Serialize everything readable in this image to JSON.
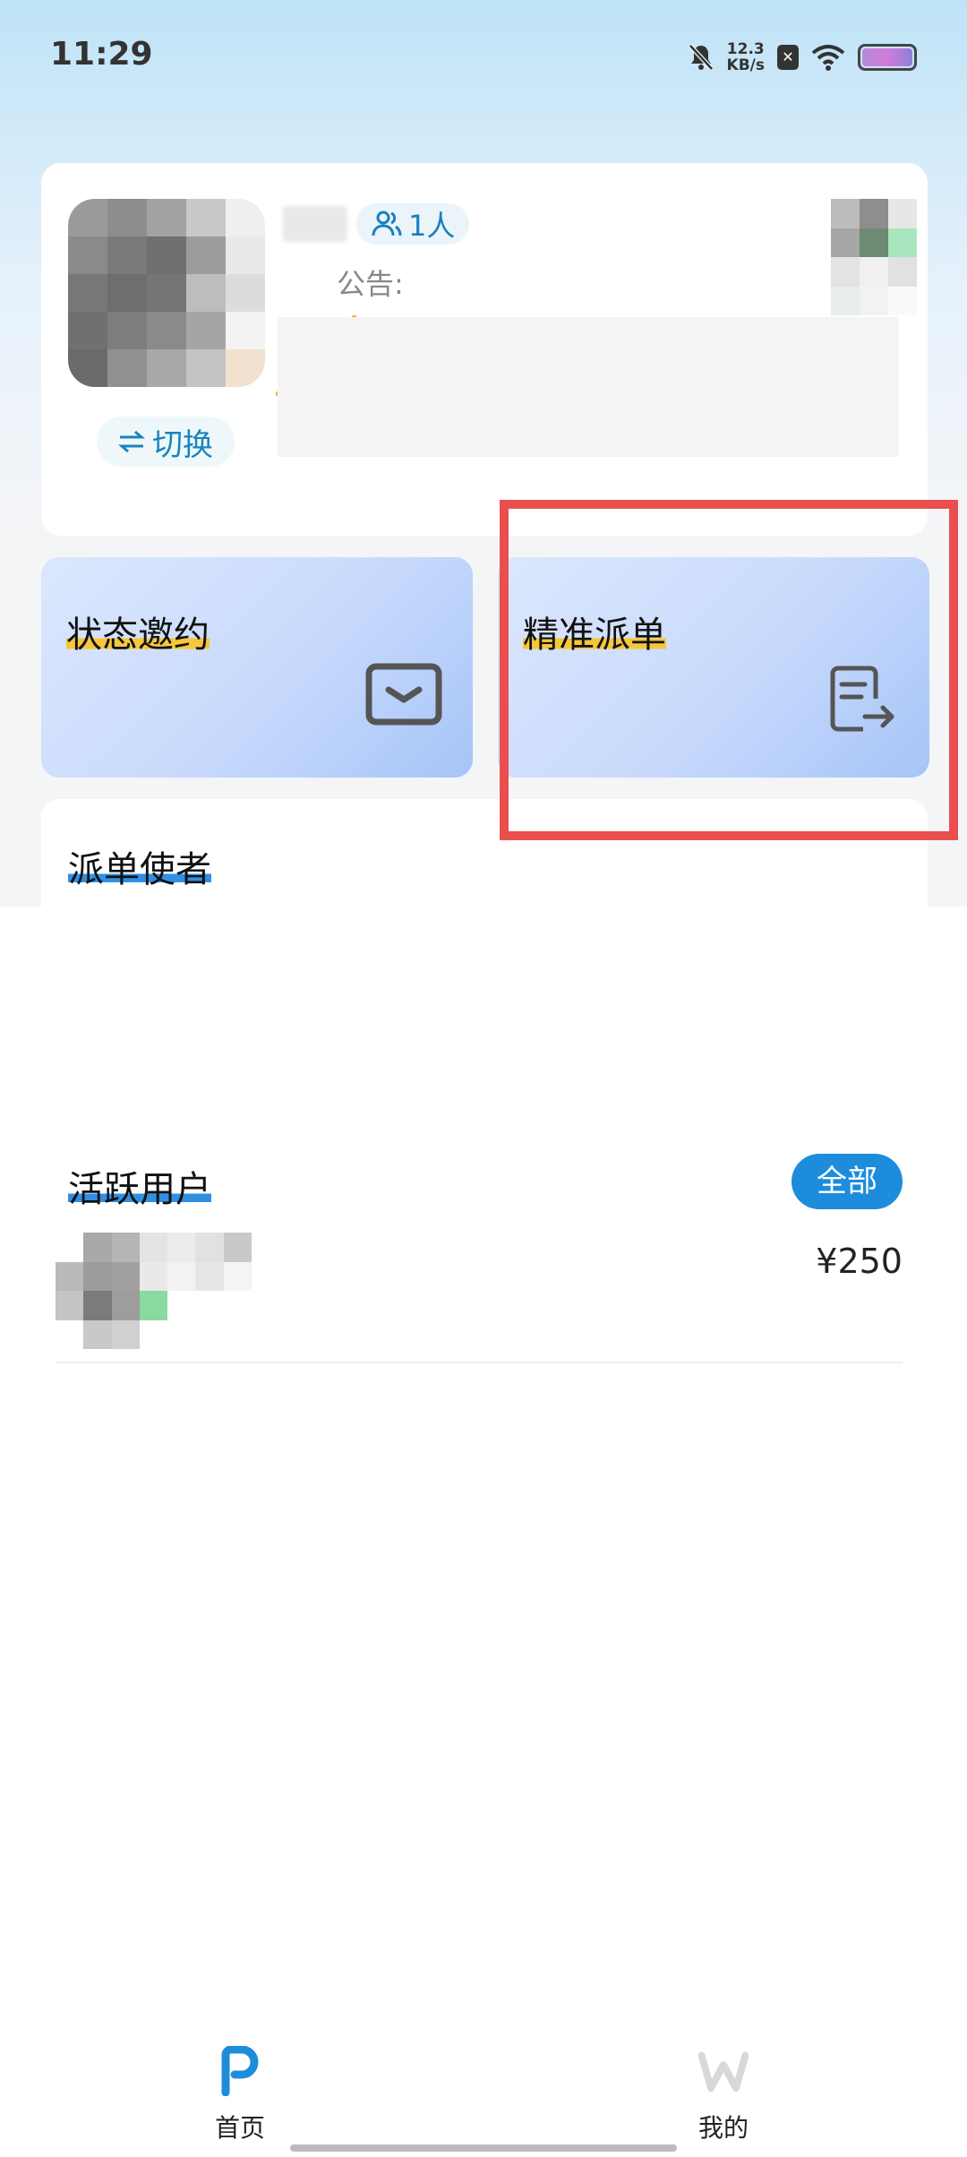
{
  "status_bar": {
    "time": "11:29",
    "speed_value": "12.3",
    "speed_unit": "KB/s",
    "icons": [
      "bell-muted-icon",
      "close-box-icon",
      "wifi-icon",
      "battery-icon"
    ]
  },
  "profile": {
    "members_count": "1人",
    "notice_label": "公告:",
    "switch_label": "切换",
    "switch_icon": "switch-arrows-icon"
  },
  "cards": {
    "invite_title": "状态邀约",
    "invite_icon": "mail-icon",
    "dispatch_title": "精准派单",
    "dispatch_icon": "document-send-icon"
  },
  "sections": {
    "dispatcher_title": "派单使者",
    "active_users_title": "活跃用户",
    "all_button": "全部"
  },
  "active_users": [
    {
      "amount": "¥250"
    }
  ],
  "bottom_nav": {
    "home_label": "首页",
    "home_icon": "p-logo-icon",
    "mine_label": "我的",
    "mine_icon": "w-logo-icon"
  },
  "colors": {
    "accent_blue": "#1d8ddb",
    "highlight_red": "#ea4f4f",
    "card_gradient_end": "#a6c4f8",
    "underline_yellow": "#f6c73a"
  }
}
